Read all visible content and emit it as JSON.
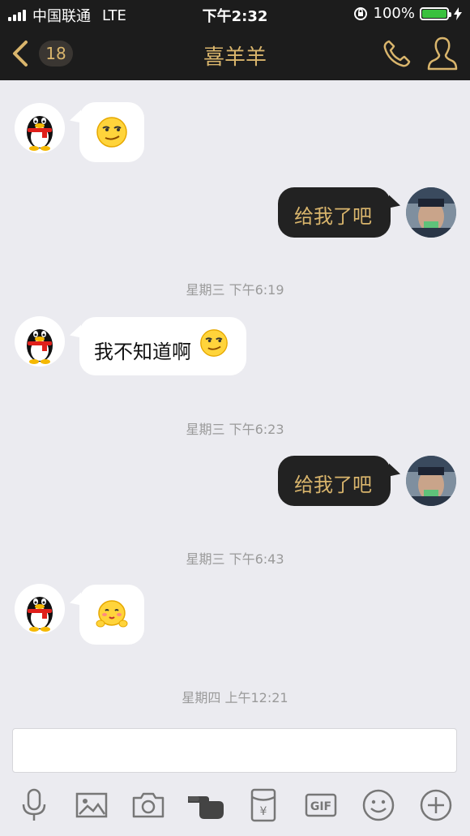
{
  "status": {
    "carrier": "中国联通",
    "network": "LTE",
    "time": "下午2:32",
    "battery": "100%"
  },
  "nav": {
    "unread_count": "18",
    "contact_name": "喜羊羊"
  },
  "messages": [
    {
      "side": "left",
      "type": "emoji",
      "emoji": "smirk-emoji"
    },
    {
      "side": "right",
      "text": "给我了吧"
    },
    {
      "type": "time",
      "text": "星期三 下午6:19"
    },
    {
      "side": "left",
      "text": "我不知道啊",
      "emoji": "smirk-emoji"
    },
    {
      "type": "time",
      "text": "星期三 下午6:23"
    },
    {
      "side": "right",
      "text": "给我了吧"
    },
    {
      "type": "time",
      "text": "星期三 下午6:43"
    },
    {
      "side": "left",
      "type": "emoji",
      "emoji": "shy-emoji"
    },
    {
      "type": "time",
      "text": "星期四 上午12:21"
    }
  ],
  "input": {
    "value": ""
  },
  "toolbar": {
    "items": [
      "microphone-icon",
      "image-icon",
      "camera-icon",
      "pointing-hand-icon",
      "red-packet-icon",
      "gif-icon",
      "emoji-icon",
      "plus-icon"
    ],
    "gif_label": "GIF",
    "red_packet_label": "¥"
  },
  "colors": {
    "accent": "#d9b56c",
    "bar": "#1c1c1c",
    "background": "#ebebf0",
    "battery": "#3ac13e"
  }
}
